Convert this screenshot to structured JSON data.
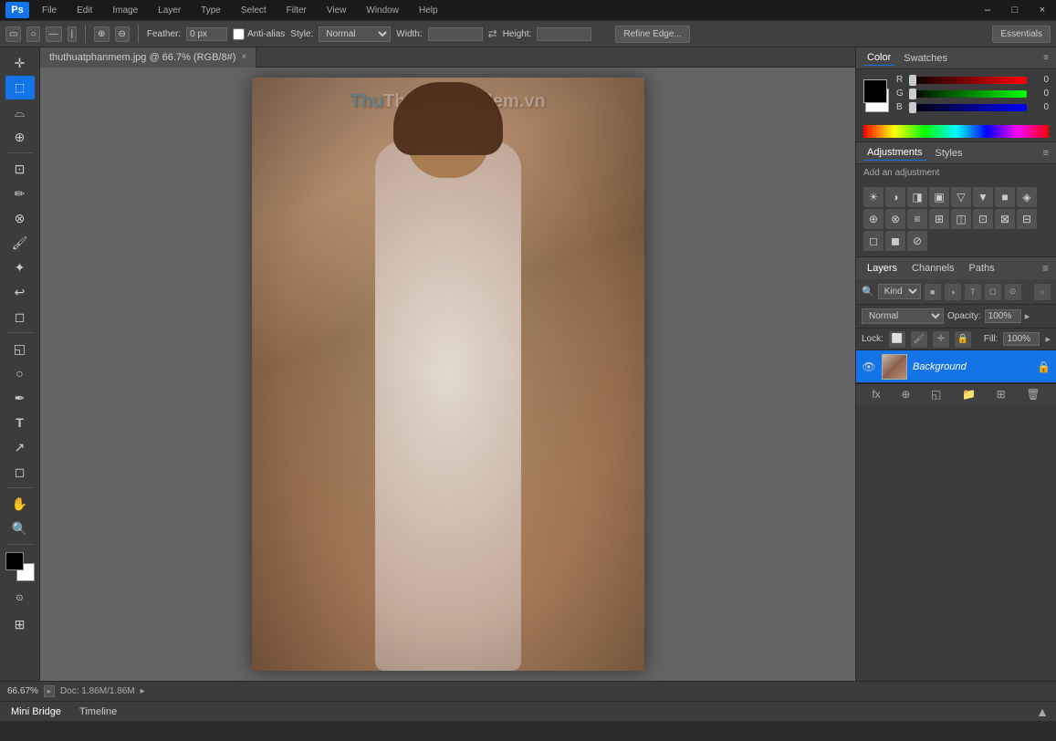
{
  "titlebar": {
    "app": "Adobe Photoshop",
    "logo": "Ps",
    "minimize": "–",
    "maximize": "□",
    "close": "×"
  },
  "menubar": {
    "items": [
      "File",
      "Edit",
      "Image",
      "Layer",
      "Type",
      "Select",
      "Filter",
      "View",
      "Window",
      "Help"
    ]
  },
  "optionsbar": {
    "feather_label": "Feather:",
    "feather_value": "0 px",
    "antialias_label": "Anti-alias",
    "style_label": "Style:",
    "style_value": "Normal",
    "width_label": "Width:",
    "height_label": "Height:",
    "refine_edge": "Refine Edge...",
    "essentials": "Essentials"
  },
  "document": {
    "tab_label": "thuthuatphanmem.jpg @ 66.7% (RGB/8#)",
    "watermark_thu": "Thu",
    "watermark_thuat": "Thuat",
    "watermark_phan": "Phan",
    "watermark_mem": "Mem",
    "watermark_vn": ".vn"
  },
  "color_panel": {
    "tab_color": "Color",
    "tab_swatches": "Swatches",
    "r_label": "R",
    "r_value": "0",
    "g_label": "G",
    "g_value": "0",
    "b_label": "B",
    "b_value": "0"
  },
  "adjustments_panel": {
    "title": "Adjustments",
    "tab_styles": "Styles",
    "add_adjustment": "Add an adjustment",
    "buttons": [
      "☀",
      "◑",
      "◨",
      "▣",
      "▽",
      "▼",
      "■",
      "◈",
      "⊕",
      "⊗",
      "≡",
      "⊞",
      "◫",
      "⊡",
      "⊠",
      "⊟",
      "◻",
      "◼",
      "⊘"
    ]
  },
  "layers_panel": {
    "tab_layers": "Layers",
    "tab_channels": "Channels",
    "tab_paths": "Paths",
    "kind_label": "Kind",
    "blend_mode": "Normal",
    "opacity_label": "Opacity:",
    "opacity_value": "100%",
    "lock_label": "Lock:",
    "fill_label": "Fill:",
    "fill_value": "100%",
    "layer_name": "Background",
    "bottom_buttons": [
      "fx",
      "⊕",
      "◱",
      "⊟",
      "✕"
    ]
  },
  "statusbar": {
    "zoom": "66.67%",
    "doc_info": "Doc: 1.86M/1.86M"
  },
  "mini_bridge": {
    "tab_bridge": "Mini Bridge",
    "tab_timeline": "Timeline"
  }
}
